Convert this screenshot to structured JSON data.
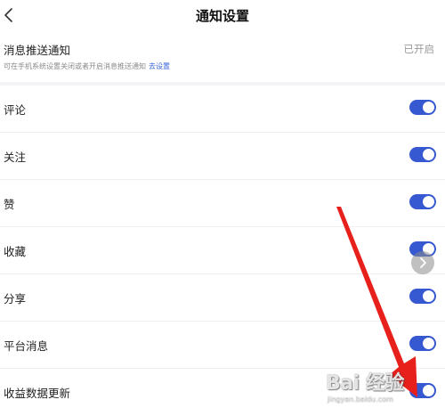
{
  "header": {
    "title": "通知设置",
    "back_icon": "chevron-left-icon"
  },
  "push": {
    "title": "消息推送通知",
    "description": "可在手机系统设置关闭或者开启消息推送通知",
    "link": "去设置",
    "status": "已开启"
  },
  "settings": [
    {
      "label": "评论",
      "enabled": true
    },
    {
      "label": "关注",
      "enabled": true
    },
    {
      "label": "赞",
      "enabled": true
    },
    {
      "label": "收藏",
      "enabled": true
    },
    {
      "label": "分享",
      "enabled": true
    },
    {
      "label": "平台消息",
      "enabled": true
    },
    {
      "label": "收益数据更新",
      "enabled": true
    }
  ],
  "colors": {
    "toggle_on": "#3658d0",
    "link": "#3a61d8",
    "annotation_arrow": "#e8201c"
  },
  "watermark": {
    "logo": "Bai 经验",
    "url": "jingyan.baidu.com"
  }
}
